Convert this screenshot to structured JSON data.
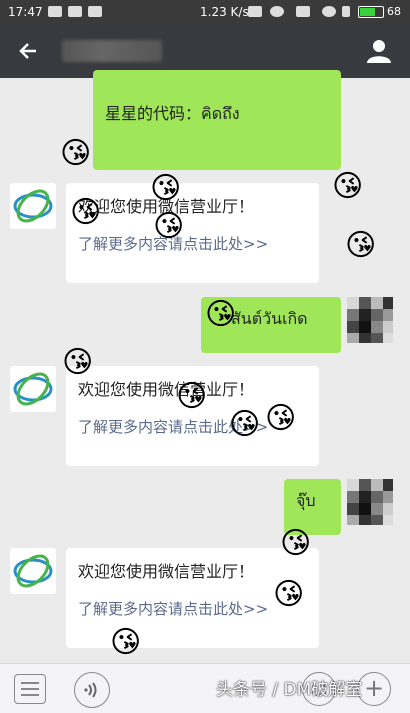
{
  "status_bar": {
    "time": "17:47",
    "speed": "1.23 K/s",
    "battery_level": 68,
    "battery": "68"
  },
  "header": {
    "back_icon": "back-arrow-icon",
    "profile_icon": "user-icon"
  },
  "messages": [
    {
      "side": "right",
      "text": "星星的代码：คิดถึง"
    },
    {
      "side": "left",
      "title": "欢迎您使用微信营业厅！",
      "link": "了解更多内容请点击此处>>"
    },
    {
      "side": "right",
      "text": "สันต์วันเกิด"
    },
    {
      "side": "left",
      "title": "欢迎您使用微信营业厅！",
      "link": "了解更多内容请点击此处>>"
    },
    {
      "side": "right",
      "text": "จุ๊บ"
    },
    {
      "side": "left",
      "title": "欢迎您使用微信营业厅！",
      "link": "了解更多内容请点击此处>>"
    }
  ],
  "emoji": "😘",
  "bottom_bar": {
    "keyboard_icon": "keyboard-icon",
    "voice_icon": "voice-icon",
    "emoji_icon": "smiley-icon",
    "plus_icon": "plus-icon"
  },
  "watermark": "头条号 / DM破解室"
}
